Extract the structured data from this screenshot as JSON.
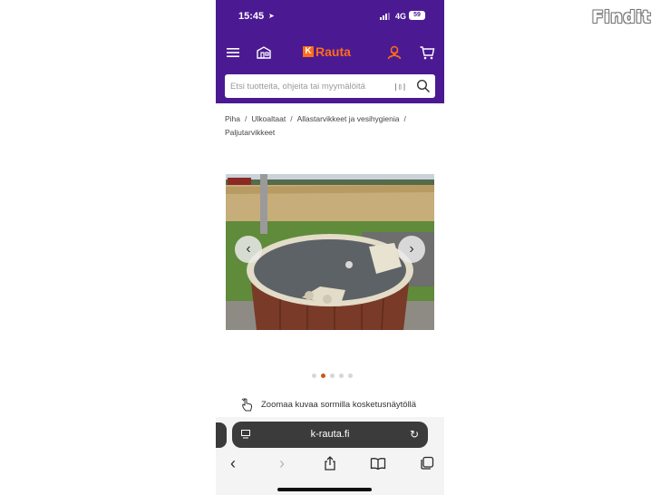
{
  "watermark": {
    "logo_text": "Findit"
  },
  "status_bar": {
    "time": "15:45",
    "network": "4G",
    "battery": "59"
  },
  "header": {
    "brand_mark": "K",
    "brand_name": "Rauta"
  },
  "search": {
    "placeholder": "Etsi tuotteita, ohjeita tai myymälöitä",
    "barcode_glyph": "|▯|"
  },
  "breadcrumb": [
    "Piha",
    "Ulkoaltaat",
    "Allastarvikkeet ja vesihygienia",
    "Paljutarvikkeet"
  ],
  "gallery": {
    "prev_glyph": "‹",
    "next_glyph": "›",
    "dot_count": 5,
    "active_index": 1
  },
  "zoom_hint": "Zoomaa kuvaa sormilla kosketusnäytöllä",
  "browser": {
    "url": "k-rauta.fi",
    "reload_glyph": "↻",
    "back_glyph": "‹",
    "forward_glyph": "›"
  },
  "colors": {
    "header_bg": "#4b1a92",
    "brand_orange": "#ff6b1a",
    "active_dot": "#c9581a"
  }
}
